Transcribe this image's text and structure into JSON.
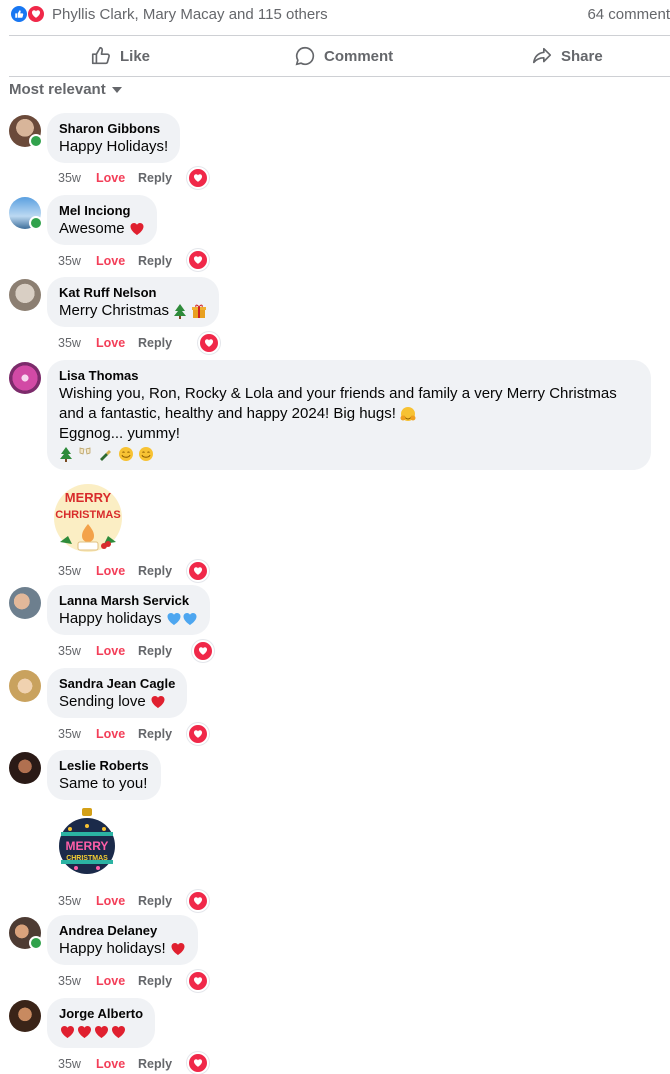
{
  "summary": {
    "names": "Phyllis Clark, Mary Macay and 115 others",
    "count": "64 comment"
  },
  "actions": {
    "like": "Like",
    "comment": "Comment",
    "share": "Share"
  },
  "sort": {
    "label": "Most relevant"
  },
  "comment_actions": {
    "time": "35w",
    "love": "Love",
    "reply": "Reply"
  },
  "comments": [
    {
      "author": "Sharon Gibbons",
      "text": "Happy Holidays!"
    },
    {
      "author": "Mel Inciong",
      "text": "Awesome"
    },
    {
      "author": "Kat Ruff Nelson",
      "text": "Merry Christmas"
    },
    {
      "author": "Lisa Thomas",
      "text1": "Wishing you, Ron, Rocky & Lola and your friends and family a very Merry Christmas and a fantastic, healthy and happy 2024! Big hugs!",
      "text2": "Eggnog... yummy!",
      "sticker_line1": "MERRY",
      "sticker_line2": "CHRISTMAS"
    },
    {
      "author": "Lanna Marsh Servick",
      "text": "Happy holidays"
    },
    {
      "author": "Sandra Jean Cagle",
      "text": "Sending love"
    },
    {
      "author": "Leslie Roberts",
      "text": "Same to you!",
      "sticker_line1": "MERRY",
      "sticker_line2": "CHRISTMAS"
    },
    {
      "author": "Andrea Delaney",
      "text": "Happy holidays!"
    },
    {
      "author": "Jorge Alberto",
      "text": ""
    }
  ],
  "colors": {
    "like": "#1877f2",
    "love": "#f02849",
    "love_text": "#f33e58",
    "muted": "#65676b",
    "bubble": "#f0f2f5"
  },
  "icons": [
    "like-reaction-icon",
    "love-reaction-icon",
    "thumbs-up-icon",
    "comment-icon",
    "share-icon",
    "caret-down-icon",
    "heart-reaction-icon"
  ]
}
